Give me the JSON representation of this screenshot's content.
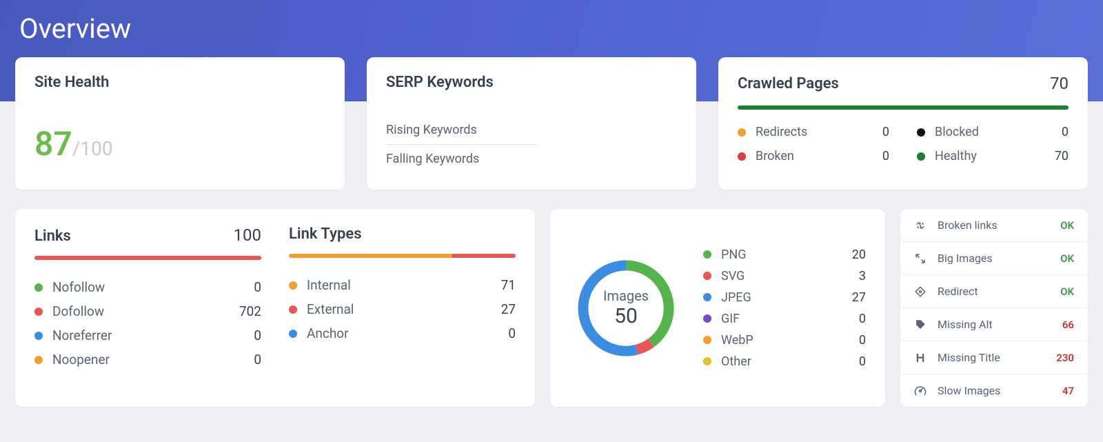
{
  "page_title": "Overview",
  "site_health": {
    "title": "Site Health",
    "score": "87",
    "max": "/100"
  },
  "serp": {
    "title": "SERP Keywords",
    "items": [
      "Rising Keywords",
      "Falling Keywords"
    ]
  },
  "crawled": {
    "title": "Crawled Pages",
    "total": "70",
    "items": [
      {
        "label": "Redirects",
        "value": "0",
        "color": "#f0a030"
      },
      {
        "label": "Blocked",
        "value": "0",
        "color": "#111"
      },
      {
        "label": "Broken",
        "value": "0",
        "color": "#e03c3c"
      },
      {
        "label": "Healthy",
        "value": "70",
        "color": "#1b7d2d"
      }
    ]
  },
  "links": {
    "title": "Links",
    "total": "100",
    "items": [
      {
        "label": "Nofollow",
        "value": "0",
        "color": "#55b54c"
      },
      {
        "label": "Dofollow",
        "value": "702",
        "color": "#e85656"
      },
      {
        "label": "Noreferrer",
        "value": "0",
        "color": "#3a8de0"
      },
      {
        "label": "Noopener",
        "value": "0",
        "color": "#f0a030"
      }
    ]
  },
  "link_types": {
    "title": "Link Types",
    "items": [
      {
        "label": "Internal",
        "value": "71",
        "color": "#f0a030"
      },
      {
        "label": "External",
        "value": "27",
        "color": "#e85656"
      },
      {
        "label": "Anchor",
        "value": "0",
        "color": "#3a8de0"
      }
    ]
  },
  "images": {
    "label": "Images",
    "total": "50",
    "items": [
      {
        "label": "PNG",
        "value": "20",
        "color": "#55b54c"
      },
      {
        "label": "SVG",
        "value": "3",
        "color": "#e85656"
      },
      {
        "label": "JPEG",
        "value": "27",
        "color": "#3a8de0"
      },
      {
        "label": "GIF",
        "value": "0",
        "color": "#7b4bc2"
      },
      {
        "label": "WebP",
        "value": "0",
        "color": "#f0a030"
      },
      {
        "label": "Other",
        "value": "0",
        "color": "#e0c22e"
      }
    ]
  },
  "checks": [
    {
      "label": "Broken links",
      "value": "OK",
      "status": "ok",
      "icon": "unlink"
    },
    {
      "label": "Big Images",
      "value": "OK",
      "status": "ok",
      "icon": "expand"
    },
    {
      "label": "Redirect",
      "value": "OK",
      "status": "ok",
      "icon": "diamond"
    },
    {
      "label": "Missing Alt",
      "value": "66",
      "status": "bad",
      "icon": "tag"
    },
    {
      "label": "Missing Title",
      "value": "230",
      "status": "bad",
      "icon": "heading"
    },
    {
      "label": "Slow Images",
      "value": "47",
      "status": "bad",
      "icon": "gauge"
    }
  ],
  "chart_data": {
    "type": "pie",
    "title": "Images",
    "categories": [
      "PNG",
      "SVG",
      "JPEG",
      "GIF",
      "WebP",
      "Other"
    ],
    "values": [
      20,
      3,
      27,
      0,
      0,
      0
    ],
    "total": 50
  }
}
